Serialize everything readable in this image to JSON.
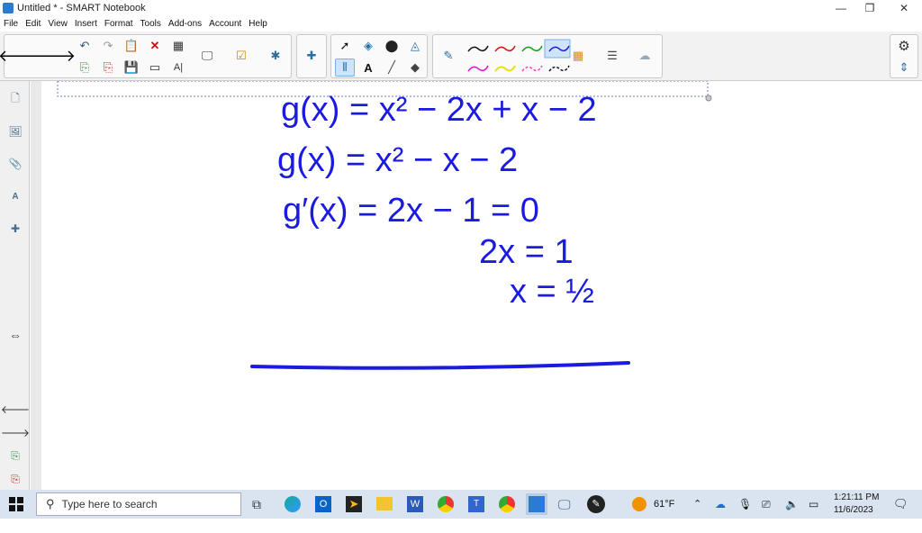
{
  "window": {
    "title": "Untitled * - SMART Notebook"
  },
  "menu": [
    "File",
    "Edit",
    "View",
    "Insert",
    "Format",
    "Tools",
    "Add-ons",
    "Account",
    "Help"
  ],
  "canvas": {
    "lines": [
      "g(x) = x² − 2x + x − 2",
      "g(x) = x² − x − 2",
      "g′(x) = 2x − 1 = 0",
      "2x = 1",
      "x = ½"
    ],
    "ink_color": "#1a1ae0"
  },
  "taskbar": {
    "search_placeholder": "Type here to search",
    "weather": "61°F",
    "time": "1:21:11 PM",
    "date": "11/6/2023"
  },
  "colors": {
    "pen_black": "#111111",
    "pen_red": "#d01010",
    "pen_green": "#10a010",
    "pen_blue": "#1a1ae0",
    "pen_magenta": "#e010d0",
    "pen_yellow": "#e8e010",
    "pen_pink": "#ff40c0"
  }
}
